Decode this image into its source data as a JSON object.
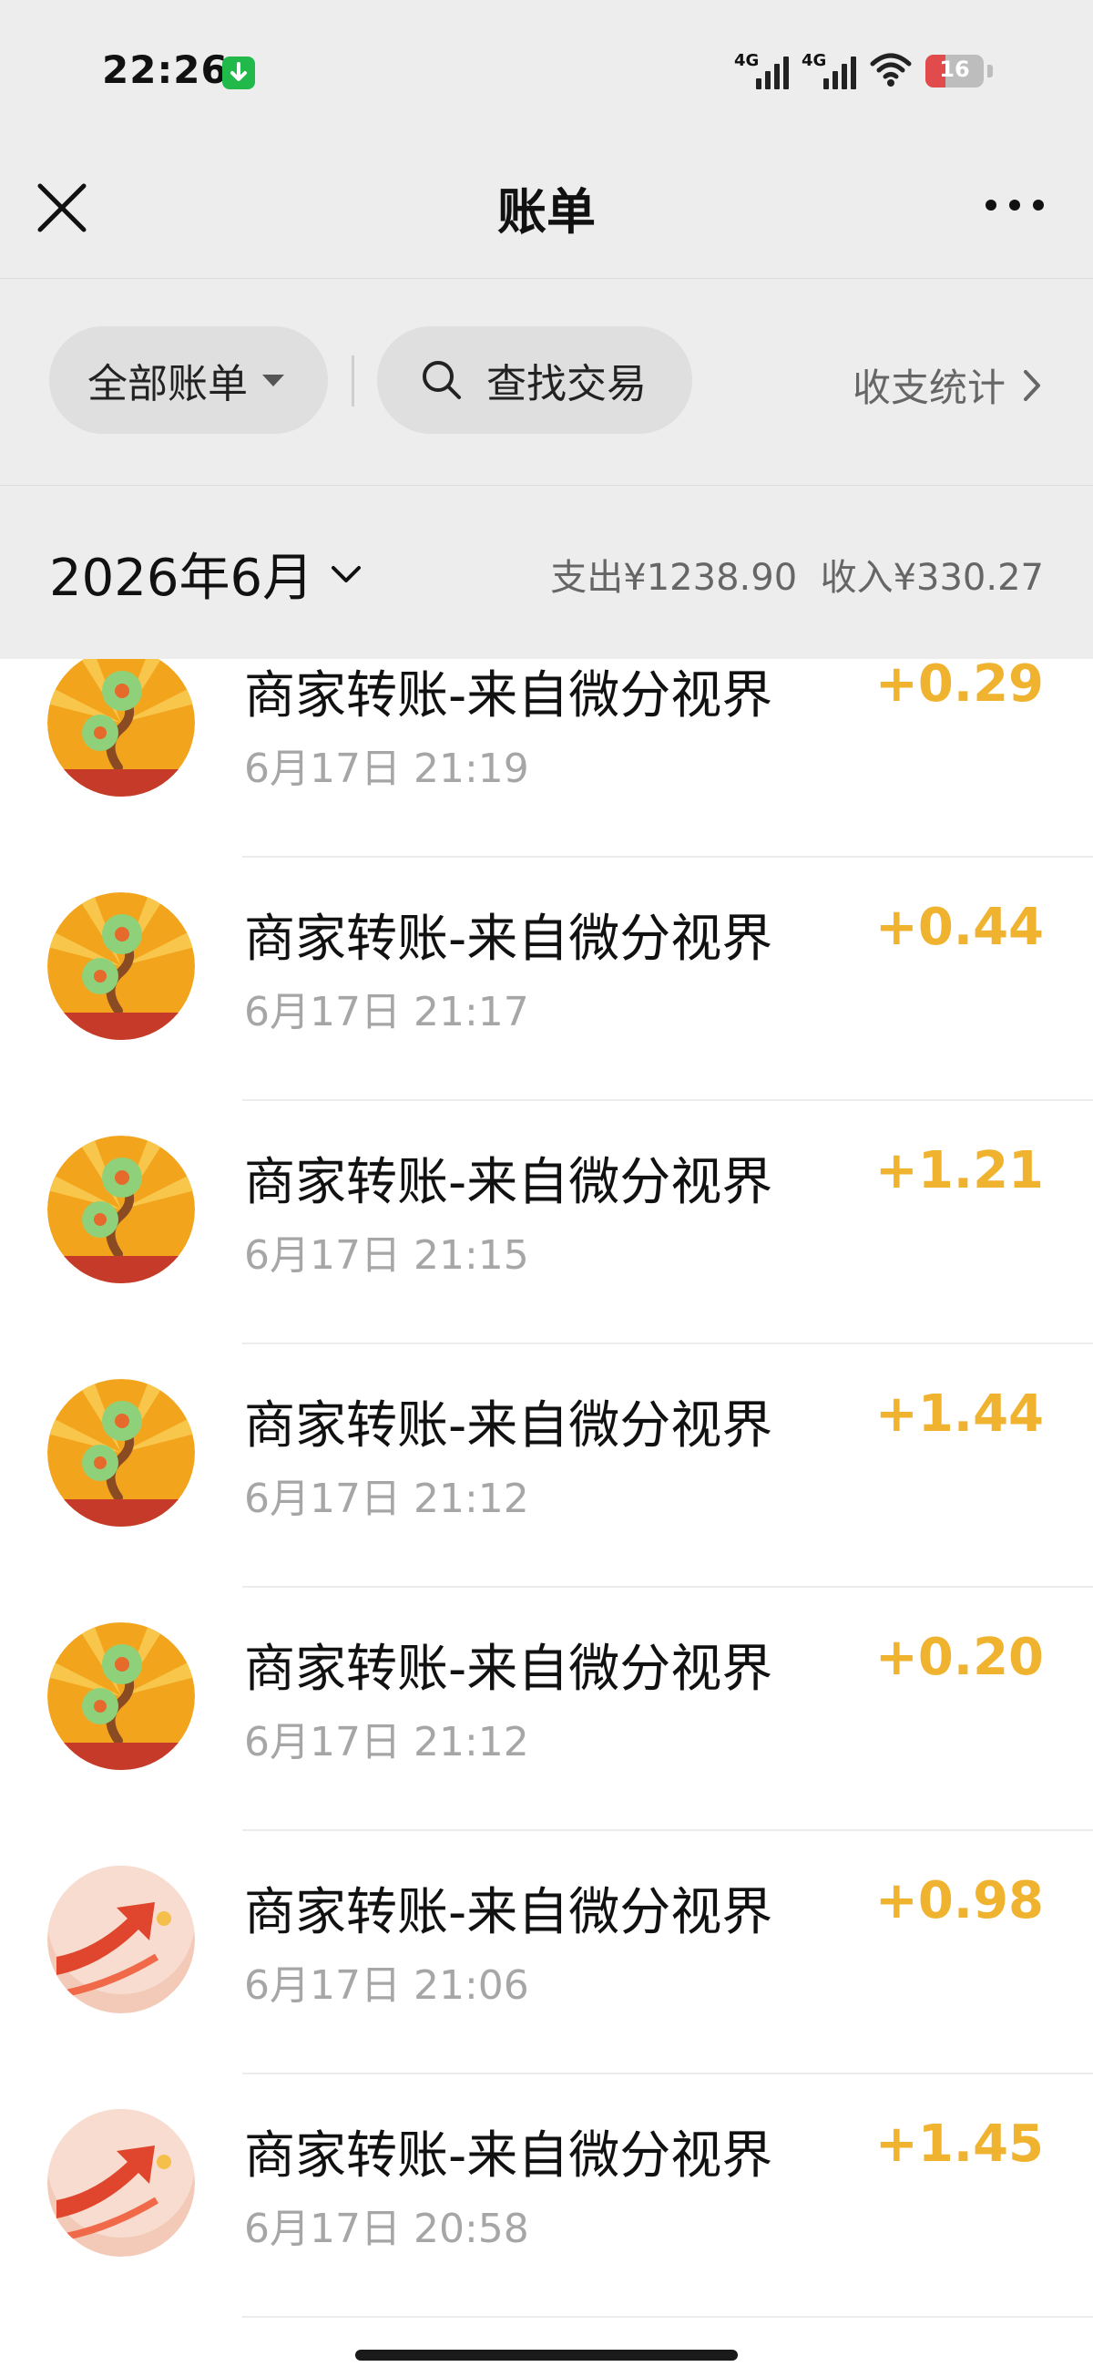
{
  "status_bar": {
    "time": "22:26",
    "net1": "4G",
    "net2": "4G",
    "battery": "16"
  },
  "nav": {
    "title": "账单"
  },
  "filters": {
    "all_bills": "全部账单",
    "search": "查找交易",
    "stats": "收支统计"
  },
  "month": {
    "label": "2026年6月",
    "expense": "支出¥1238.90",
    "income": "收入¥330.27"
  },
  "colors": {
    "amount": "#f0b330",
    "header_bg": "#ededed"
  },
  "transactions": [
    {
      "title": "商家转账-来自微分视界",
      "time": "6月17日 21:19",
      "amount": "+0.29",
      "avatar": "money-tree-icon"
    },
    {
      "title": "商家转账-来自微分视界",
      "time": "6月17日 21:17",
      "amount": "+0.44",
      "avatar": "money-tree-icon"
    },
    {
      "title": "商家转账-来自微分视界",
      "time": "6月17日 21:15",
      "amount": "+1.21",
      "avatar": "money-tree-icon"
    },
    {
      "title": "商家转账-来自微分视界",
      "time": "6月17日 21:12",
      "amount": "+1.44",
      "avatar": "money-tree-icon"
    },
    {
      "title": "商家转账-来自微分视界",
      "time": "6月17日 21:12",
      "amount": "+0.20",
      "avatar": "money-tree-icon"
    },
    {
      "title": "商家转账-来自微分视界",
      "time": "6月17日 21:06",
      "amount": "+0.98",
      "avatar": "red-arrow-icon"
    },
    {
      "title": "商家转账-来自微分视界",
      "time": "6月17日 20:58",
      "amount": "+1.45",
      "avatar": "red-arrow-icon"
    }
  ]
}
